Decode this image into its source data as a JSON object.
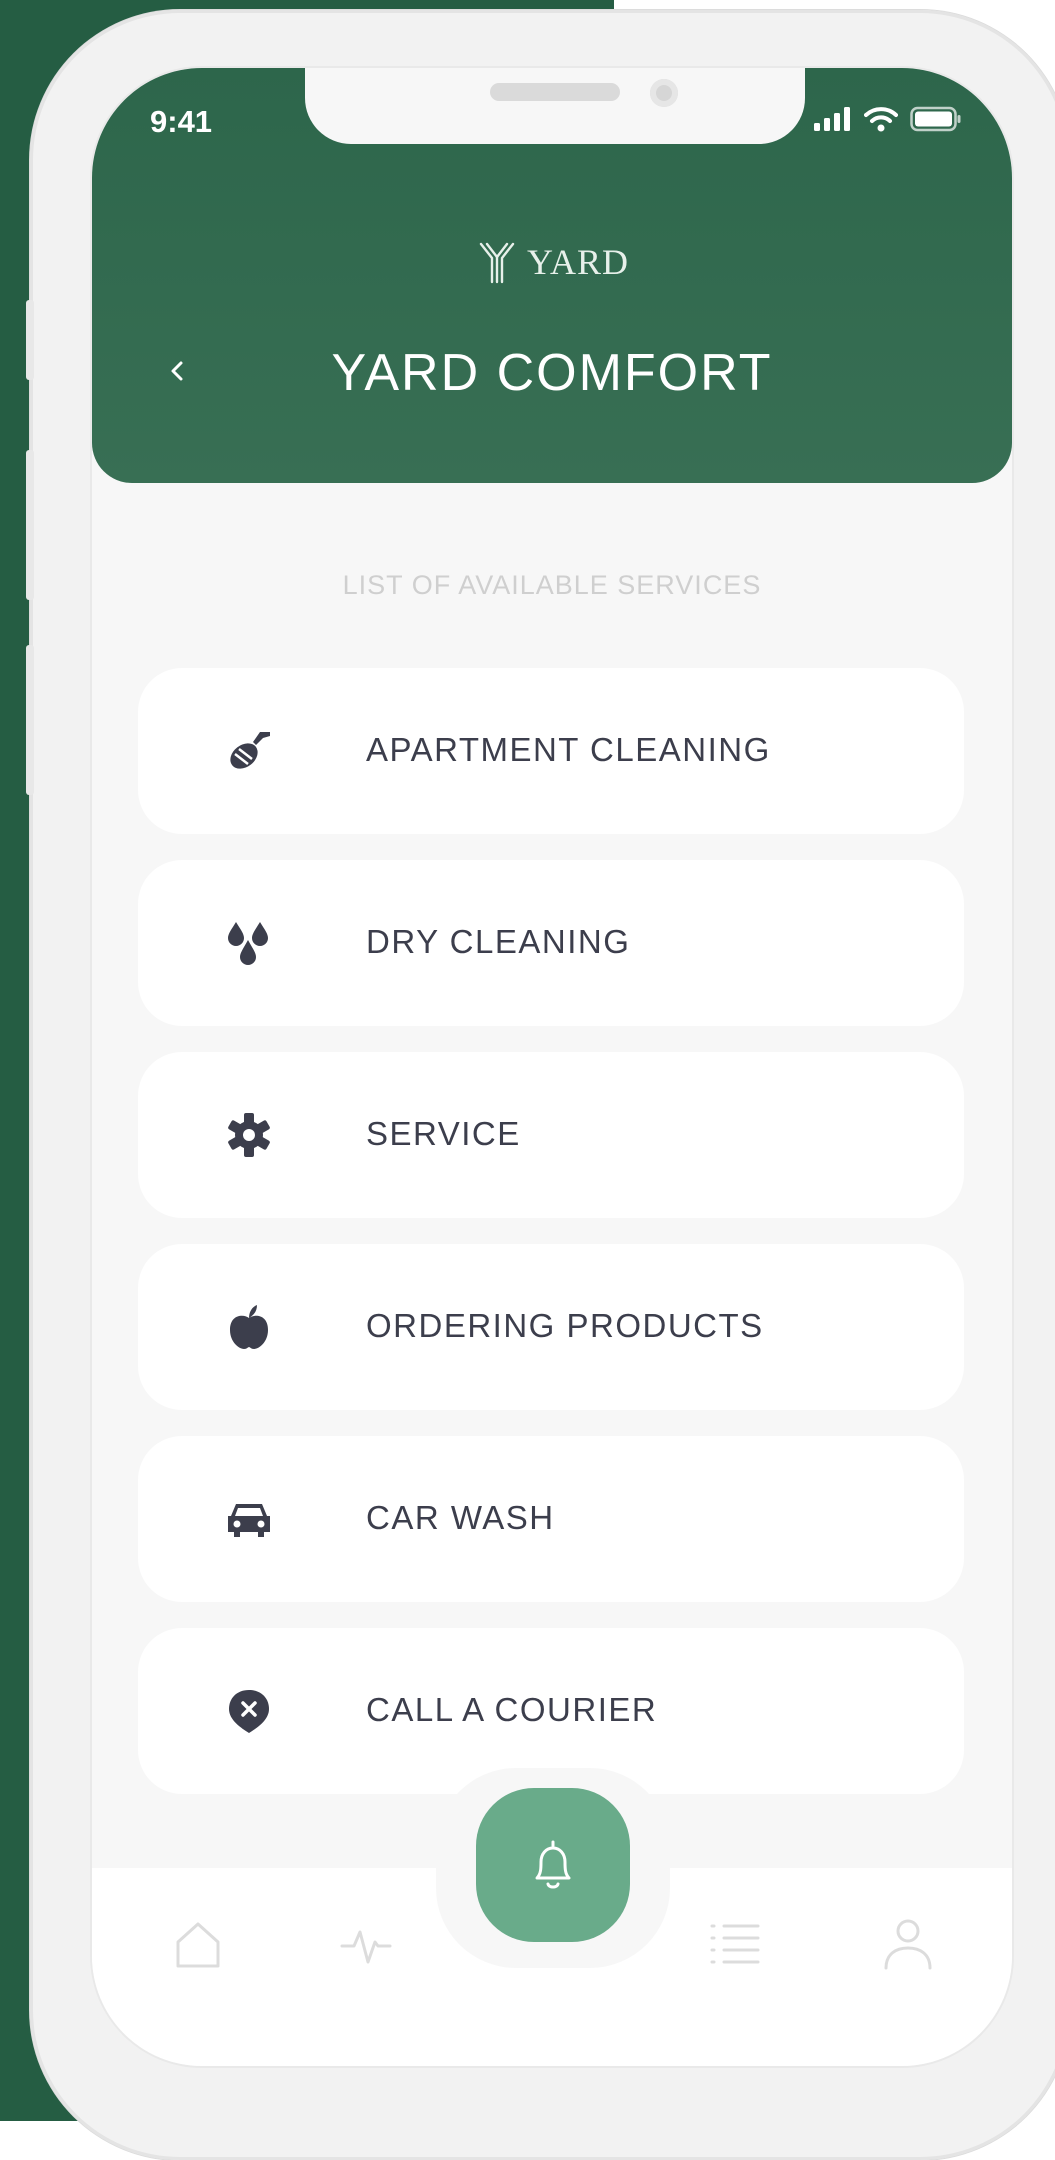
{
  "status_bar": {
    "time": "9:41"
  },
  "header": {
    "brand": "YARD",
    "title": "YARD COMFORT"
  },
  "section_title": "LIST OF AVAILABLE SERVICES",
  "services": [
    {
      "label": "APARTMENT CLEANING",
      "icon": "broom-icon"
    },
    {
      "label": "DRY CLEANING",
      "icon": "droplets-icon"
    },
    {
      "label": "SERVICE",
      "icon": "gear-icon"
    },
    {
      "label": "ORDERING PRODUCTS",
      "icon": "apple-icon"
    },
    {
      "label": "CAR WASH",
      "icon": "car-icon"
    },
    {
      "label": "CALL A COURIER",
      "icon": "location-pin-icon"
    }
  ],
  "tab_bar": {
    "items": [
      "home-icon",
      "activity-icon",
      "bell-icon",
      "list-icon",
      "profile-icon"
    ]
  },
  "colors": {
    "brand_green": "#2d664b",
    "accent_green": "#69ab8a",
    "text_dark": "#3c3e4c"
  }
}
